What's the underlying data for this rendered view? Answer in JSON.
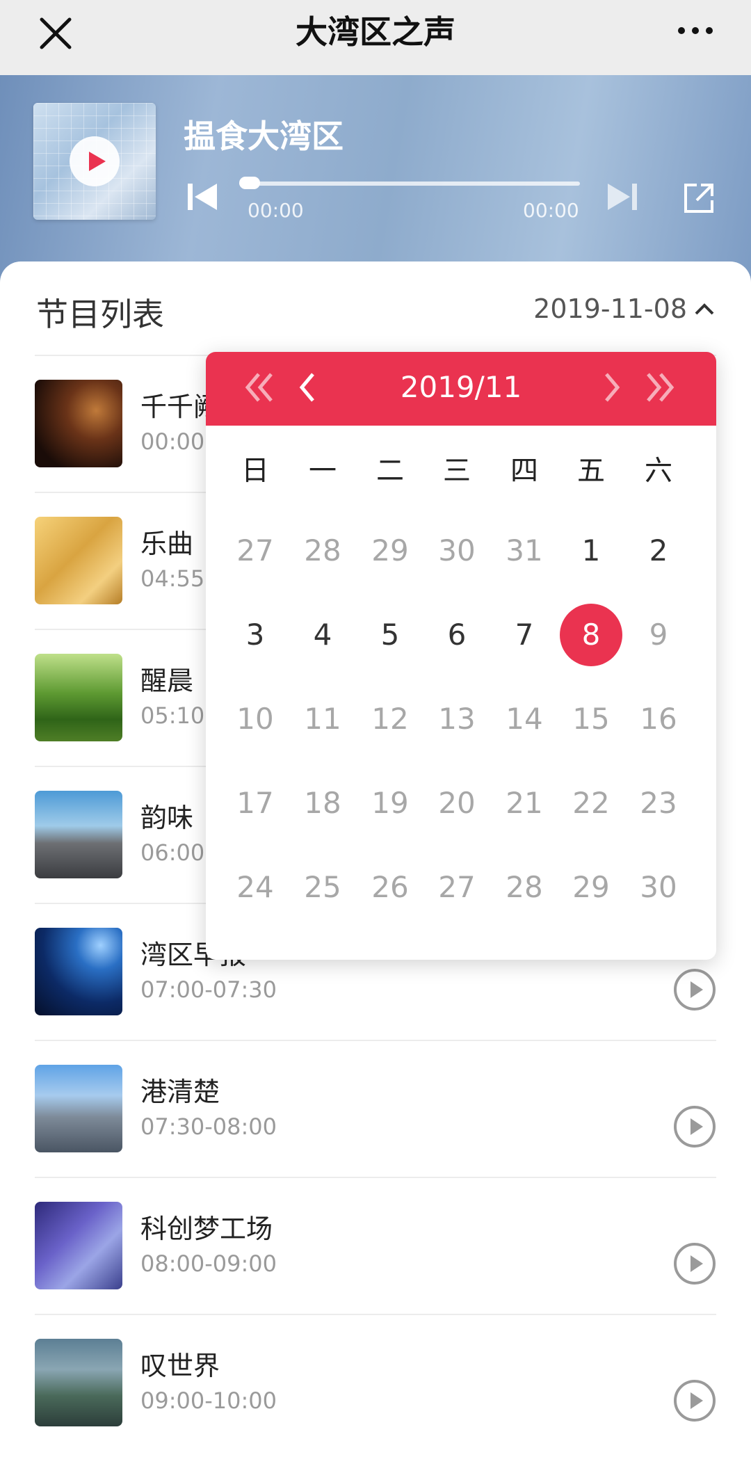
{
  "nav": {
    "title": "大湾区之声",
    "close_icon": "close-icon",
    "more_icon": "more-icon"
  },
  "player": {
    "title": "揾食大湾区",
    "time_current": "00:00",
    "time_total": "00:00",
    "progress": 0
  },
  "program_list": {
    "title": "节目列表",
    "date": "2019-11-08",
    "items": [
      {
        "name": "千千阙",
        "time": "00:00"
      },
      {
        "name": "乐曲",
        "time": "04:55"
      },
      {
        "name": "醒晨",
        "time": "05:10"
      },
      {
        "name": "韵味",
        "time": "06:00"
      },
      {
        "name": "湾区早报",
        "time": "07:00-07:30"
      },
      {
        "name": "港清楚",
        "time": "07:30-08:00"
      },
      {
        "name": "科创梦工场",
        "time": "08:00-09:00"
      },
      {
        "name": "叹世界",
        "time": "09:00-10:00"
      }
    ]
  },
  "calendar": {
    "month": "2019/11",
    "weekdays": [
      "日",
      "一",
      "二",
      "三",
      "四",
      "五",
      "六"
    ],
    "days": [
      [
        "27",
        "28",
        "29",
        "30",
        "31",
        "1",
        "2"
      ],
      [
        "3",
        "4",
        "5",
        "6",
        "7",
        "8",
        "9"
      ],
      [
        "10",
        "11",
        "12",
        "13",
        "14",
        "15",
        "16"
      ],
      [
        "17",
        "18",
        "19",
        "20",
        "21",
        "22",
        "23"
      ],
      [
        "24",
        "25",
        "26",
        "27",
        "28",
        "29",
        "30"
      ]
    ],
    "selected": "8",
    "accent": "#ea3350"
  }
}
